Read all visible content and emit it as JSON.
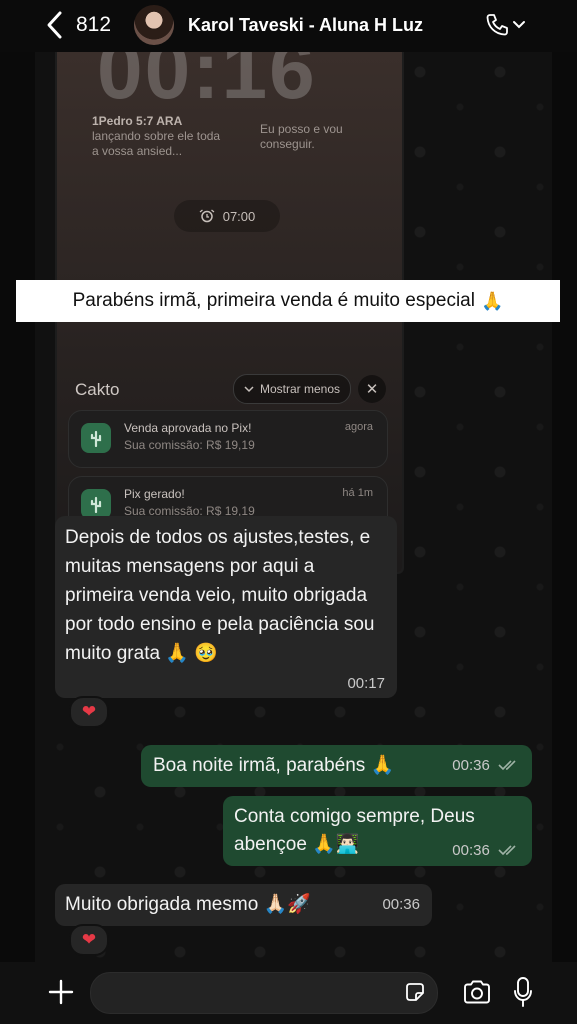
{
  "header": {
    "back_count": "812",
    "contact_name": "Karol Taveski - Aluna H Luz"
  },
  "screenshot": {
    "clock": "00:16",
    "verse_ref": "1Pedro 5:7 ARA",
    "verse_text": "lançando sobre ele toda a vossa ansied...",
    "note": "Eu posso e vou conseguir.",
    "alarm_time": "07:00",
    "notif_group": "Cakto",
    "show_less": "Mostrar menos",
    "notifications": [
      {
        "title": "Venda aprovada no Pix!",
        "sub": "Sua comissão: R$ 19,19",
        "time": "agora"
      },
      {
        "title": "Pix gerado!",
        "sub": "Sua comissão: R$ 19,19",
        "time": "há 1m"
      }
    ]
  },
  "caption": {
    "text": "Parabéns irmã, primeira venda é muito especial",
    "emoji": "🙏"
  },
  "messages": [
    {
      "text": "Depois de todos os ajustes,testes, e muitas mensagens por aqui a primeira venda veio, muito obrigada por todo ensino e pela paciência sou muito grata 🙏 🥹",
      "time": "00:17",
      "reaction": "❤"
    },
    {
      "text": "Boa noite irmã, parabéns 🙏",
      "time": "00:36"
    },
    {
      "text": "Conta comigo sempre, Deus abençoe 🙏👨🏻‍💻",
      "time": "00:36"
    },
    {
      "text": "Muito obrigada mesmo 🙏🏻🚀",
      "time": "00:36",
      "reaction": "❤"
    }
  ],
  "colors": {
    "outgoing_bubble": "#1f4a30",
    "incoming_bubble": "#262626",
    "read_ticks": "#9fb3a6"
  }
}
